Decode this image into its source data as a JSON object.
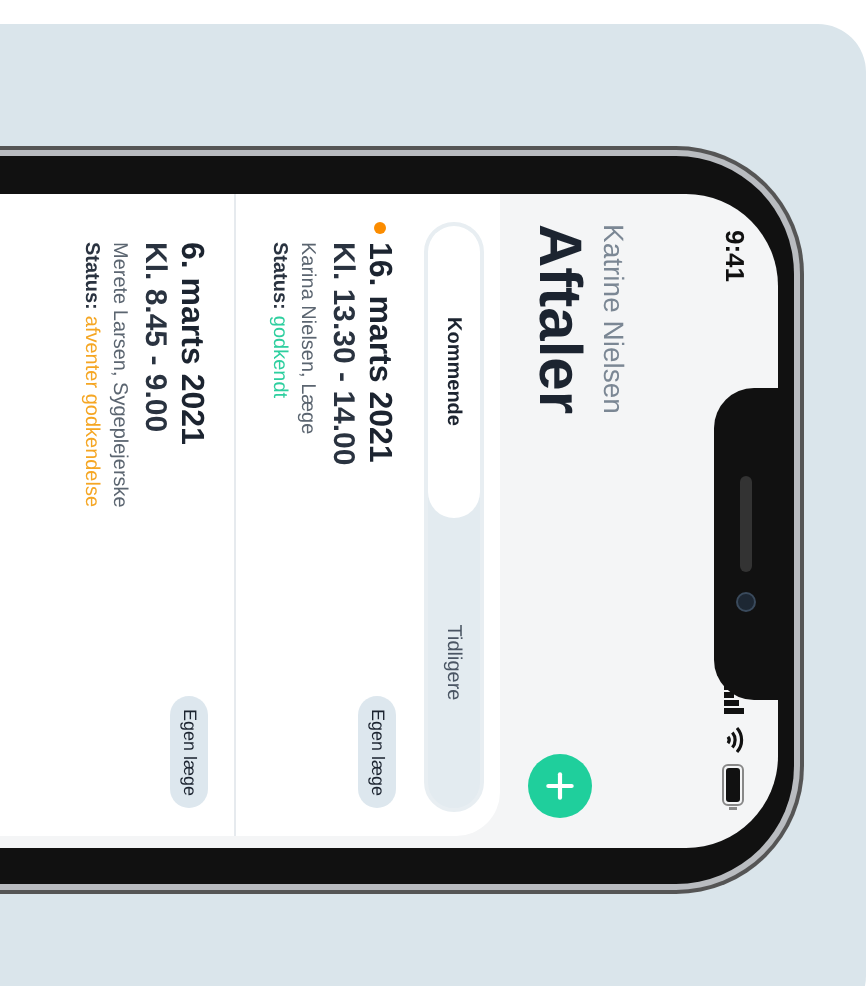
{
  "status_bar": {
    "time": "9:41"
  },
  "header": {
    "user": "Katrine Nielsen",
    "title": "Aftaler"
  },
  "tabs": [
    {
      "label": "Kommende",
      "selected": true
    },
    {
      "label": "Tidligere",
      "selected": false
    }
  ],
  "appointments": [
    {
      "date": "16. marts 2021",
      "time": "Kl. 13.30 - 14.00",
      "staff": "Karina Nielsen, Læge",
      "status_label": "Status:",
      "status": "godkendt",
      "color": "#2ecf9f",
      "unread": true,
      "tag": "Egen læge"
    },
    {
      "date": "6. marts 2021",
      "time": "Kl. 8.45 - 9.00",
      "staff": "Merete Larsen, Sygeplejerske",
      "status_label": "Status:",
      "status": "afventer godkendelse",
      "color": "#f5a623",
      "unread": false,
      "tag": "Egen læge"
    }
  ]
}
